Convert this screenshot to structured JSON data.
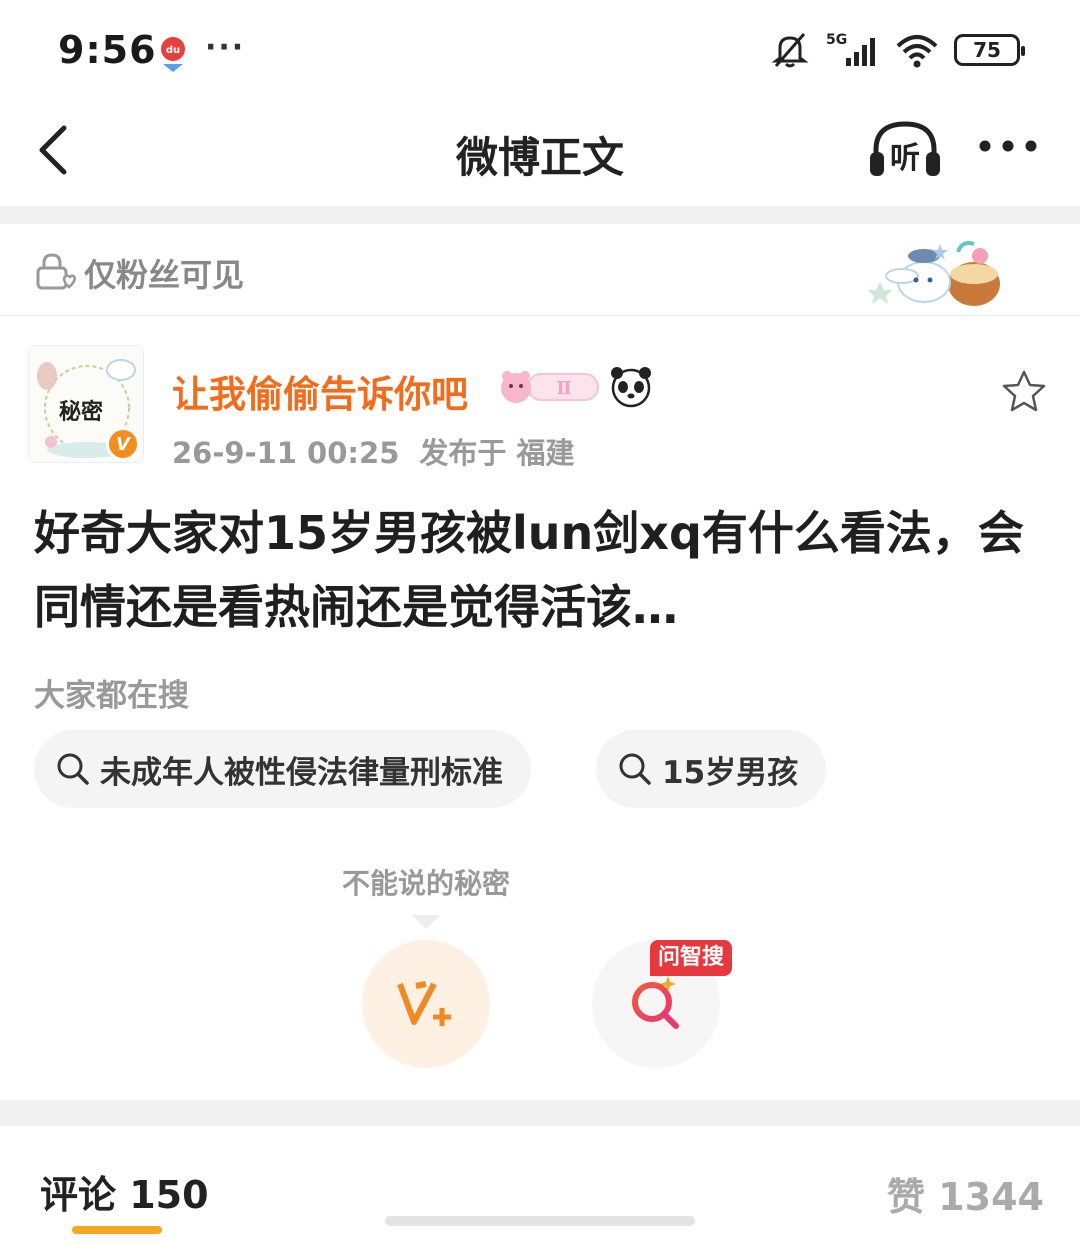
{
  "status_bar": {
    "time": "9:56",
    "more": "···",
    "network": "5G",
    "battery": "75",
    "icons": [
      "map-app-icon",
      "mute-bell-icon",
      "signal-icon",
      "wifi-icon",
      "battery-icon"
    ]
  },
  "nav": {
    "title": "微博正文",
    "listen_label": "听"
  },
  "fans_only": {
    "label": "仅粉丝可见"
  },
  "post": {
    "avatar_text": "秘密",
    "vip_label": "V",
    "username": "让我偷偷告诉你吧",
    "member_badge": "Ⅱ",
    "datetime": "26-9-11 00:25",
    "location": "发布于 福建",
    "text": "好奇大家对15岁男孩被lun剑xq有什么看法，会同情还是看热闹还是觉得活该…"
  },
  "search": {
    "label": "大家都在搜",
    "chips": [
      "未成年人被性侵法律量刑标准",
      "15岁男孩"
    ]
  },
  "actions": {
    "tooltip": "不能说的秘密",
    "ai_tag": "问智搜"
  },
  "tabs": {
    "comments": "评论 150",
    "likes": "赞 1344"
  },
  "colors": {
    "accent": "#f36b1b",
    "underline": "#f6a623",
    "ai_tag": "#e8383d",
    "separator": "#f1f1f1"
  }
}
